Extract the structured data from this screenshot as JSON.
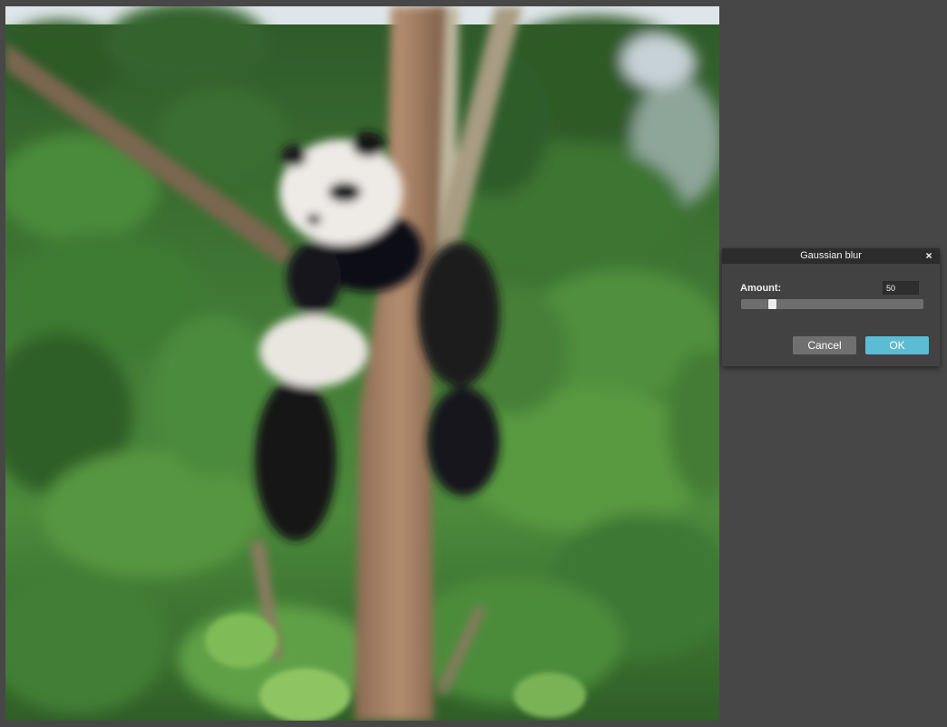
{
  "dialog": {
    "title": "Gaussian blur",
    "close_glyph": "×",
    "amount_label": "Amount:",
    "amount_value": "50",
    "slider": {
      "min": 0,
      "max": 300,
      "value": 50
    },
    "cancel_label": "Cancel",
    "ok_label": "OK"
  },
  "image": {
    "subject": "blurred photo of a panda cub resting in a tree with green forest background"
  },
  "colors": {
    "workspace_bg": "#474747",
    "dialog_bg": "#424242",
    "titlebar_bg": "#2c2c2c",
    "cancel_bg": "#707070",
    "ok_bg": "#5bbcd4"
  },
  "icons": {
    "close": "close-icon"
  }
}
